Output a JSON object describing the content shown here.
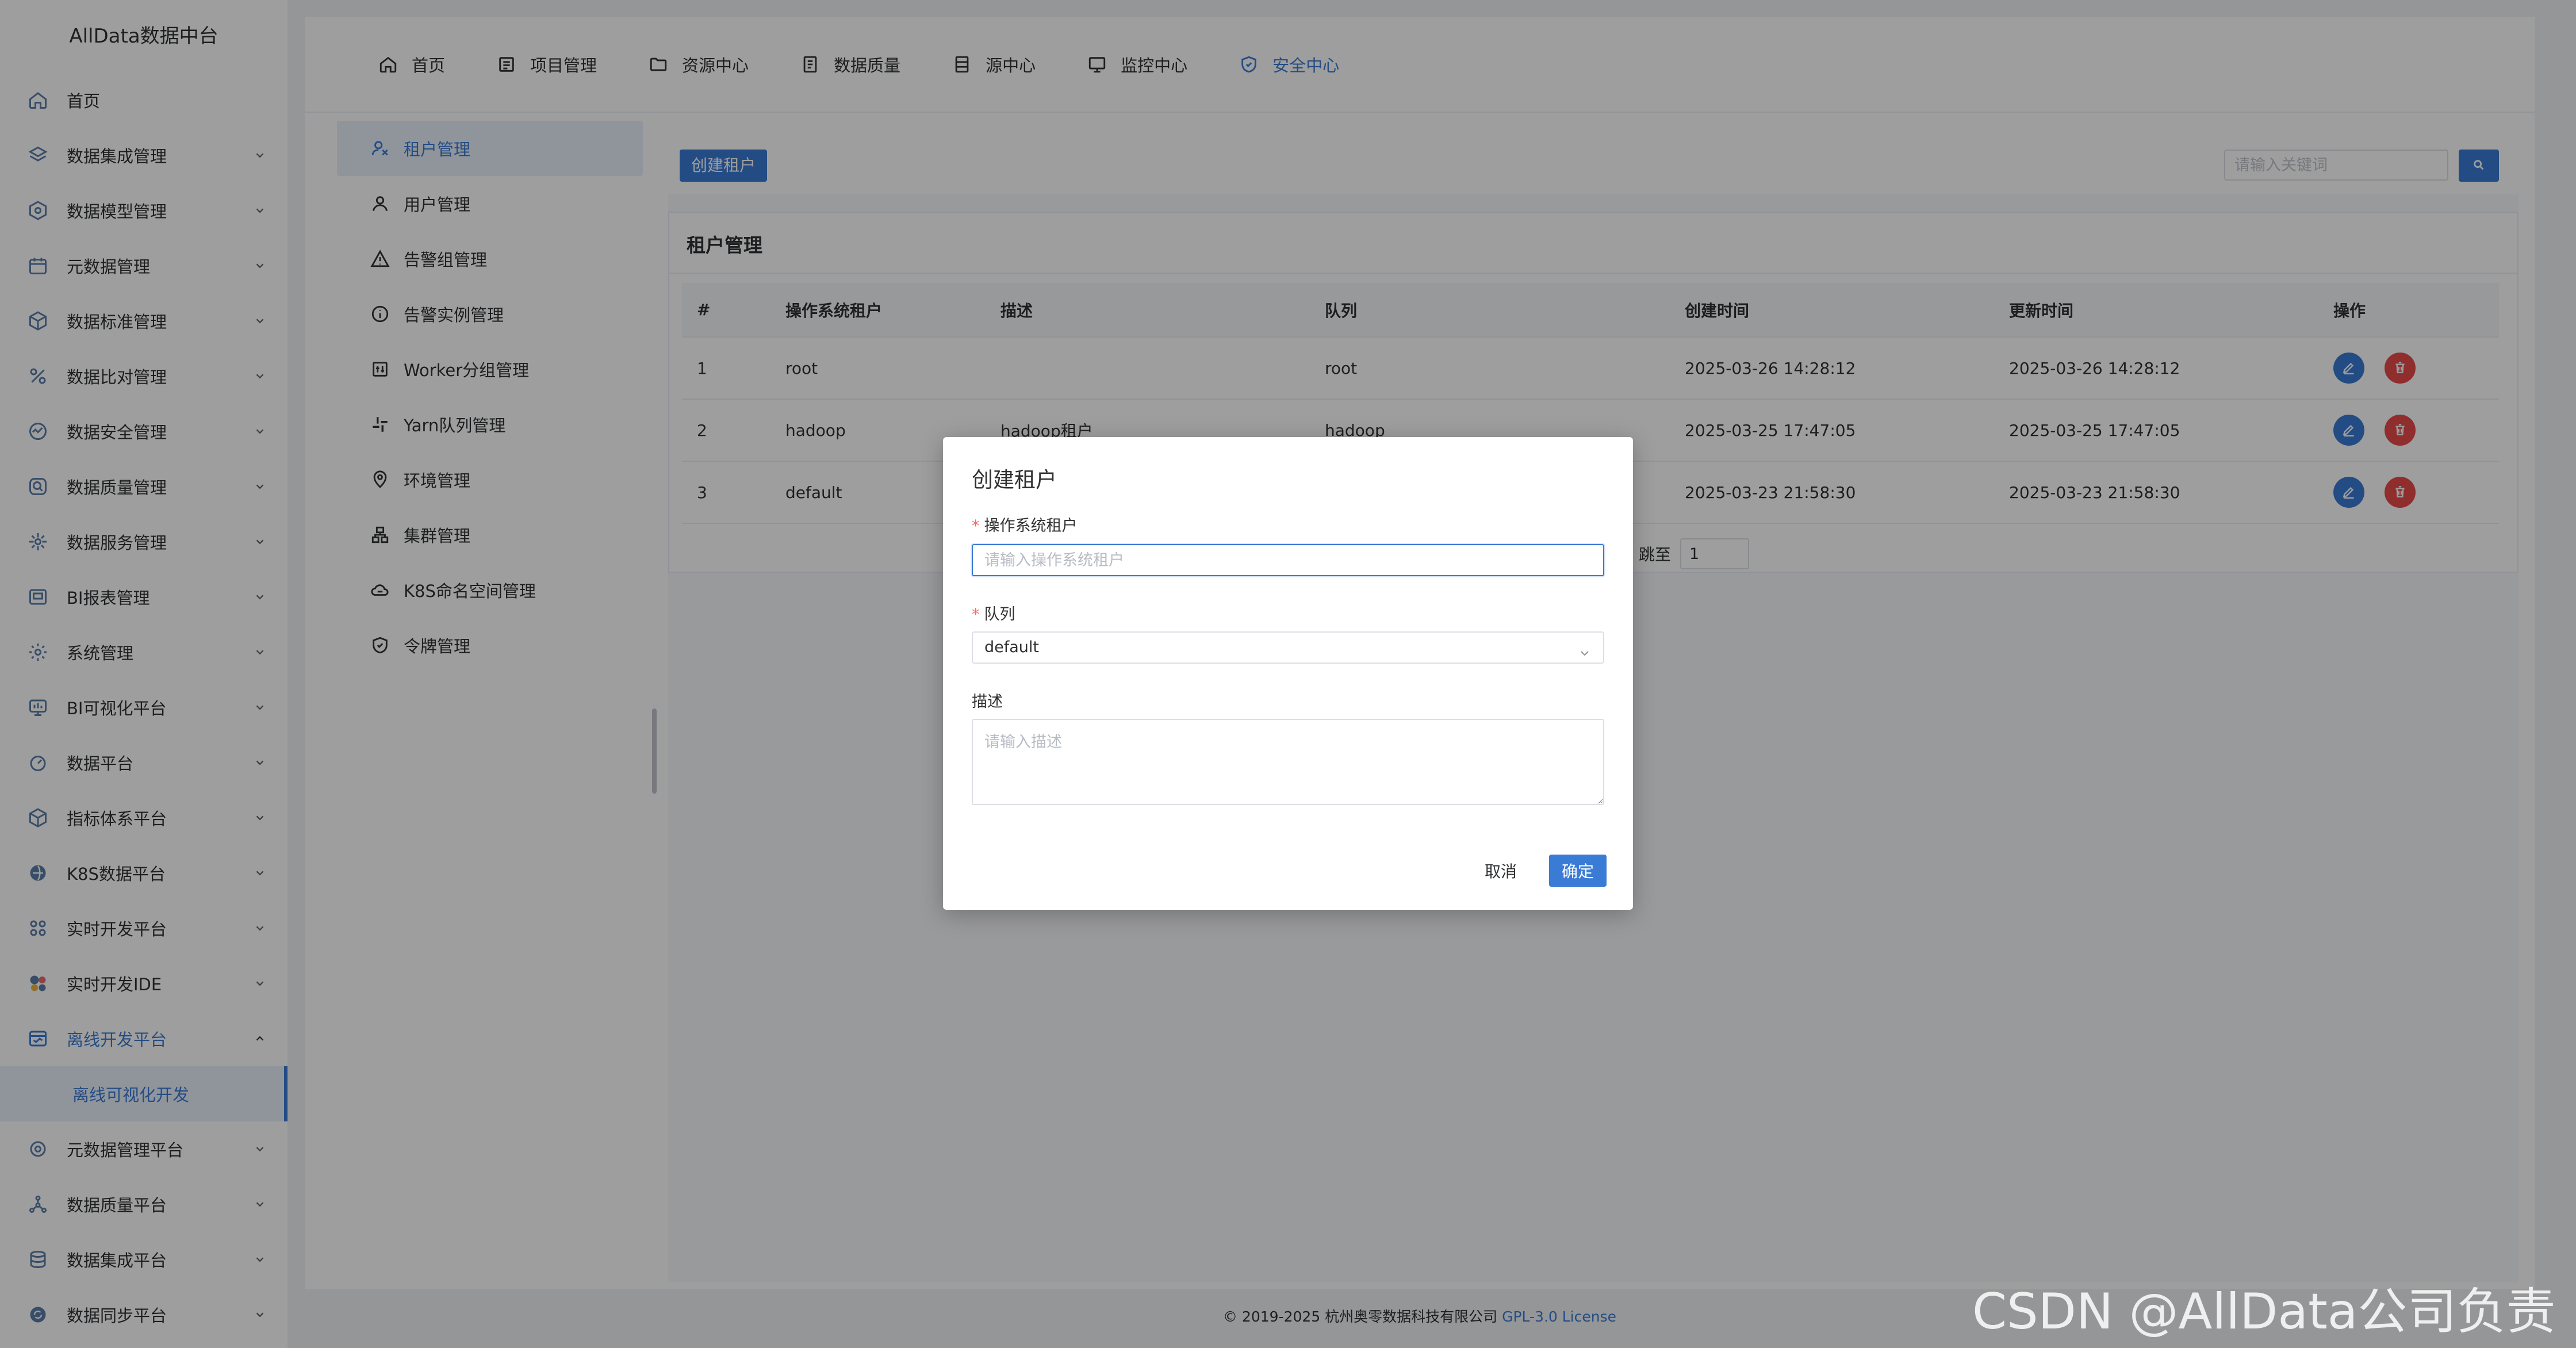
{
  "brand": "AllData数据中台",
  "sidebar": {
    "items": [
      {
        "label": "首页",
        "icon": "home-icon"
      },
      {
        "label": "数据集成管理",
        "icon": "layers-icon"
      },
      {
        "label": "数据模型管理",
        "icon": "cube-icon"
      },
      {
        "label": "元数据管理",
        "icon": "calendar-icon"
      },
      {
        "label": "数据标准管理",
        "icon": "box-icon"
      },
      {
        "label": "数据比对管理",
        "icon": "percent-icon"
      },
      {
        "label": "数据安全管理",
        "icon": "chart-icon"
      },
      {
        "label": "数据质量管理",
        "icon": "search-shield-icon"
      },
      {
        "label": "数据服务管理",
        "icon": "service-icon"
      },
      {
        "label": "BI报表管理",
        "icon": "report-icon"
      },
      {
        "label": "系统管理",
        "icon": "gear-icon"
      },
      {
        "label": "BI可视化平台",
        "icon": "monitor-icon"
      },
      {
        "label": "数据平台",
        "icon": "gauge-icon"
      },
      {
        "label": "指标体系平台",
        "icon": "cube-icon"
      },
      {
        "label": "K8S数据平台",
        "icon": "globe-icon"
      },
      {
        "label": "实时开发平台",
        "icon": "nodes-icon"
      },
      {
        "label": "实时开发IDE",
        "icon": "ide-icon"
      },
      {
        "label": "离线开发平台",
        "icon": "offline-icon"
      },
      {
        "label": "元数据管理平台",
        "icon": "refresh-icon"
      },
      {
        "label": "数据质量平台",
        "icon": "network-icon"
      },
      {
        "label": "数据集成平台",
        "icon": "stack-icon"
      },
      {
        "label": "数据同步平台",
        "icon": "sync-icon"
      }
    ],
    "sub_item": "离线可视化开发"
  },
  "topnav": [
    {
      "label": "首页",
      "icon": "home-icon"
    },
    {
      "label": "项目管理",
      "icon": "project-icon"
    },
    {
      "label": "资源中心",
      "icon": "folder-icon"
    },
    {
      "label": "数据质量",
      "icon": "document-icon"
    },
    {
      "label": "源中心",
      "icon": "database-icon"
    },
    {
      "label": "监控中心",
      "icon": "monitor-icon"
    },
    {
      "label": "安全中心",
      "icon": "shield-icon"
    }
  ],
  "submenu": [
    {
      "label": "租户管理",
      "icon": "tenant-icon"
    },
    {
      "label": "用户管理",
      "icon": "user-icon"
    },
    {
      "label": "告警组管理",
      "icon": "warning-icon"
    },
    {
      "label": "告警实例管理",
      "icon": "info-icon"
    },
    {
      "label": "Worker分组管理",
      "icon": "worker-icon"
    },
    {
      "label": "Yarn队列管理",
      "icon": "slack-icon"
    },
    {
      "label": "环境管理",
      "icon": "location-icon"
    },
    {
      "label": "集群管理",
      "icon": "cluster-icon"
    },
    {
      "label": "K8S命名空间管理",
      "icon": "cloud-icon"
    },
    {
      "label": "令牌管理",
      "icon": "token-shield-icon"
    }
  ],
  "toolbar": {
    "create_label": "创建租户",
    "search_placeholder": "请输入关键词"
  },
  "card_title": "租户管理",
  "table": {
    "headers": [
      "#",
      "操作系统租户",
      "描述",
      "队列",
      "创建时间",
      "更新时间",
      "操作"
    ],
    "rows": [
      {
        "id": "1",
        "tenant": "root",
        "desc": "",
        "queue": "root",
        "created": "2025-03-26 14:28:12",
        "updated": "2025-03-26 14:28:12"
      },
      {
        "id": "2",
        "tenant": "hadoop",
        "desc": "hadoop租户",
        "queue": "hadoop",
        "created": "2025-03-25 17:47:05",
        "updated": "2025-03-25 17:47:05"
      },
      {
        "id": "3",
        "tenant": "default",
        "desc": "",
        "queue": "",
        "created": "2025-03-23 21:58:30",
        "updated": "2025-03-23 21:58:30"
      }
    ]
  },
  "pager": {
    "jump_label": "跳至",
    "page": "1"
  },
  "footer": {
    "text": "© 2019-2025 杭州奥零数据科技有限公司 ",
    "license": "GPL-3.0 License"
  },
  "dialog": {
    "title": "创建租户",
    "tenant_label": "操作系统租户",
    "tenant_placeholder": "请输入操作系统租户",
    "queue_label": "队列",
    "queue_value": "default",
    "desc_label": "描述",
    "desc_placeholder": "请输入描述",
    "cancel": "取消",
    "ok": "确定"
  },
  "watermark": "CSDN @AllData公司负责人",
  "colors": {
    "accent": "#3a7bd5",
    "danger": "#e84a4a",
    "required": "#f56c6c"
  }
}
